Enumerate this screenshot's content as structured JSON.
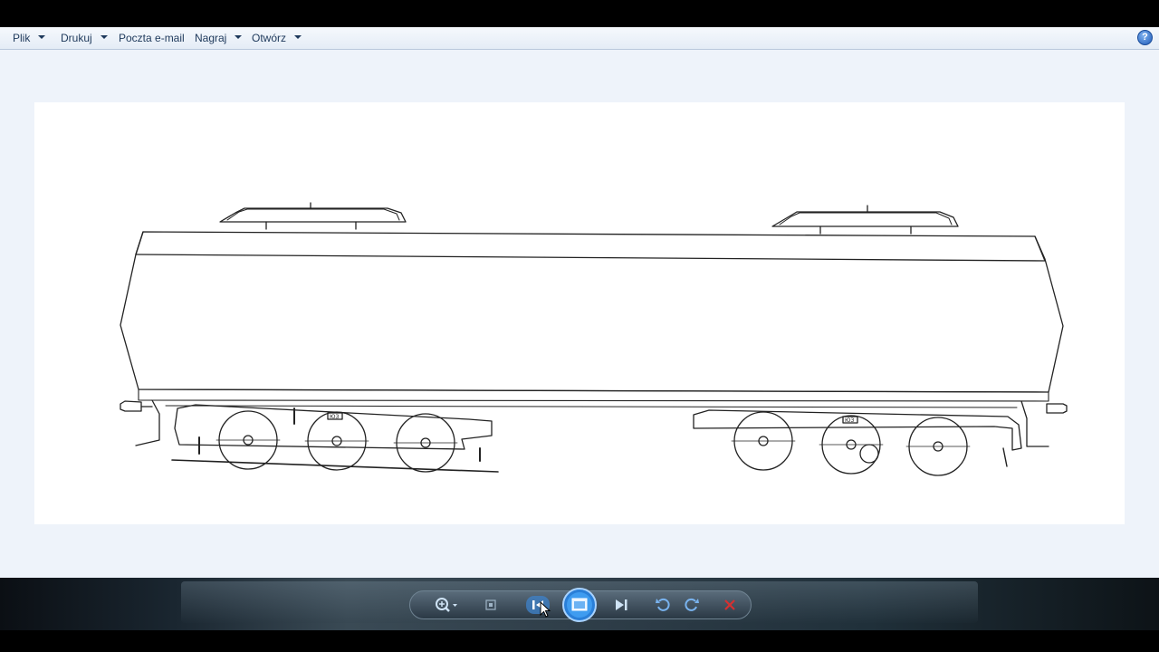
{
  "menu": {
    "items": [
      {
        "label": "Plik",
        "has_dropdown": true
      },
      {
        "label": "Drukuj",
        "has_dropdown": true
      },
      {
        "label": "Poczta e-mail",
        "has_dropdown": false
      },
      {
        "label": "Nagraj",
        "has_dropdown": true
      },
      {
        "label": "Otwórz",
        "has_dropdown": true
      }
    ],
    "help_glyph": "?"
  },
  "controls": [
    {
      "name": "zoom-button",
      "icon": "magnifier-icon"
    },
    {
      "name": "actual-size-button",
      "icon": "fit-icon"
    },
    {
      "name": "previous-button",
      "icon": "previous-icon"
    },
    {
      "name": "slideshow-button",
      "icon": "slideshow-icon"
    },
    {
      "name": "next-button",
      "icon": "next-icon"
    },
    {
      "name": "rotate-ccw-button",
      "icon": "rotate-left-icon"
    },
    {
      "name": "rotate-cw-button",
      "icon": "rotate-right-icon"
    },
    {
      "name": "delete-button",
      "icon": "delete-icon"
    }
  ],
  "colors": {
    "menu_text": "#1e395b",
    "viewer_bg": "#eef3fa",
    "delete_red": "#d63030",
    "slideshow_blue": "#2a7fd8"
  },
  "picture": {
    "subject": "line drawing of railway tank wagon",
    "label_left_bogie": "ЮЗ",
    "label_right_bogie": "ЮЗ"
  }
}
